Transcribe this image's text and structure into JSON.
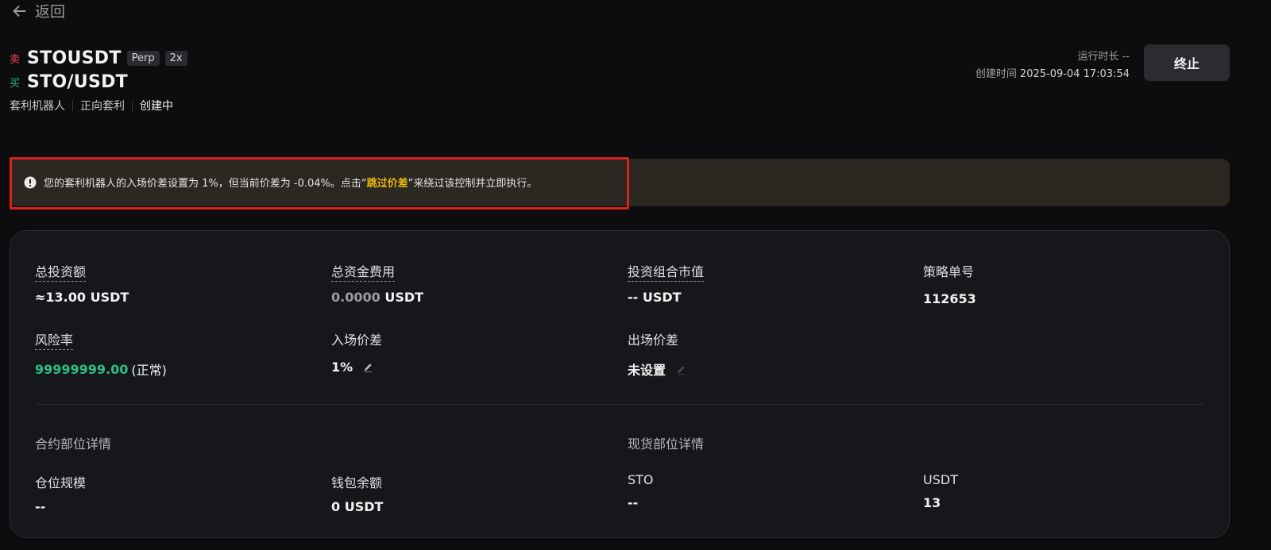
{
  "nav": {
    "back_label": "返回"
  },
  "header": {
    "sell_tag": "卖",
    "sell_pair": "STOUSDT",
    "badge_perp": "Perp",
    "badge_leverage": "2x",
    "buy_tag": "买",
    "buy_pair": "STO/USDT",
    "tags": [
      "套利机器人",
      "正向套利",
      "创建中"
    ],
    "runtime_label": "运行时长",
    "runtime_value": "--",
    "created_label": "创建时间",
    "created_value": "2025-09-04 17:03:54",
    "stop_label": "终止"
  },
  "alert": {
    "text_before": "您的套利机器人的入场价差设置为 1%，但当前价差为 -0.04%。点击“",
    "link": "跳过价差",
    "text_after": "”来绕过该控制并立即执行。"
  },
  "summary": {
    "total_invest_label": "总投资额",
    "total_invest_value": "≈13.00",
    "total_invest_unit": "USDT",
    "funding_label": "总资金费用",
    "funding_value": "0.0000",
    "funding_unit": "USDT",
    "portfolio_label": "投资组合市值",
    "portfolio_value": "--",
    "portfolio_unit": "USDT",
    "order_label": "策略单号",
    "order_value": "112653",
    "risk_label": "风险率",
    "risk_value": "99999999.00",
    "risk_status": "(正常)",
    "entry_label": "入场价差",
    "entry_value": "1%",
    "exit_label": "出场价差",
    "exit_value": "未设置"
  },
  "positions": {
    "futures_title": "合约部位详情",
    "spot_title": "现货部位详情",
    "size_label": "仓位规模",
    "size_value": "--",
    "wallet_label": "钱包余额",
    "wallet_value": "0 USDT",
    "sto_label": "STO",
    "sto_value": "--",
    "usdt_label": "USDT",
    "usdt_value": "13"
  },
  "colors": {
    "accent": "#f0b90b",
    "sell": "#f0455b",
    "buy": "#2ebd85",
    "highlight_box": "#d8211b"
  }
}
